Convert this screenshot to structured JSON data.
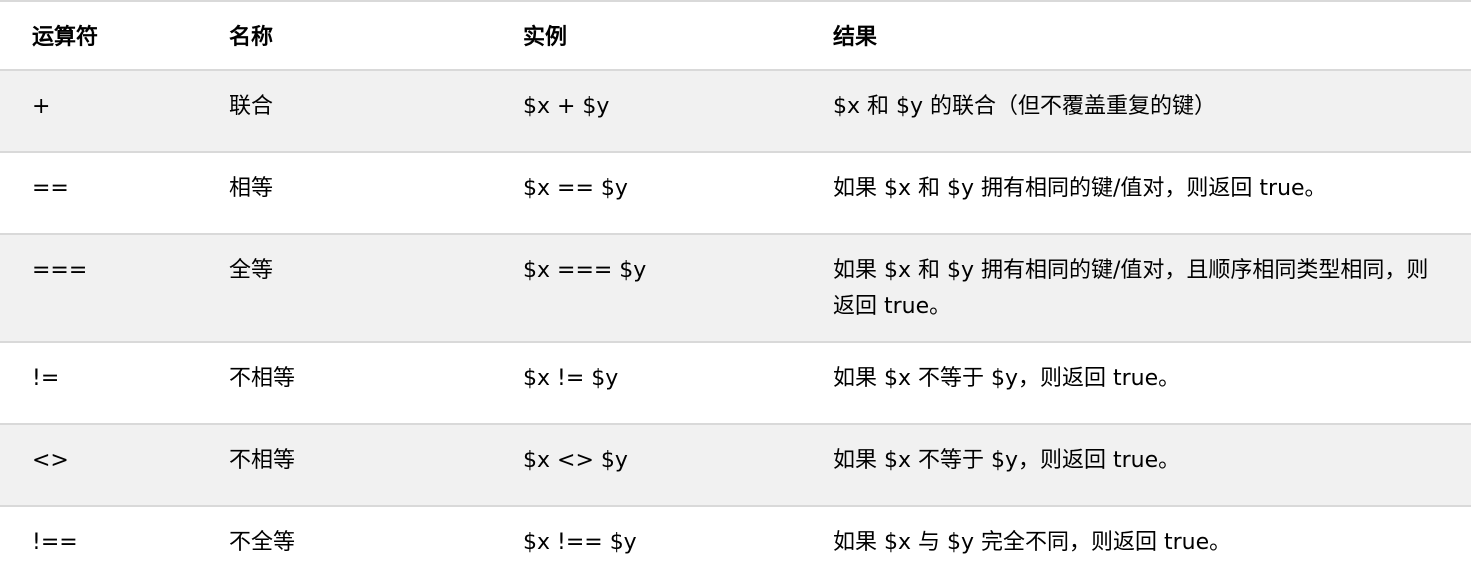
{
  "table": {
    "headers": [
      "运算符",
      "名称",
      "实例",
      "结果"
    ],
    "rows": [
      {
        "operator": "+",
        "name": "联合",
        "example": "$x + $y",
        "result": "$x 和 $y 的联合（但不覆盖重复的键）"
      },
      {
        "operator": "==",
        "name": "相等",
        "example": "$x == $y",
        "result": "如果 $x 和 $y 拥有相同的键/值对，则返回 true。"
      },
      {
        "operator": "===",
        "name": "全等",
        "example": "$x === $y",
        "result": "如果 $x 和 $y 拥有相同的键/值对，且顺序相同类型相同，则返回 true。"
      },
      {
        "operator": "!=",
        "name": "不相等",
        "example": "$x != $y",
        "result": "如果 $x 不等于 $y，则返回 true。"
      },
      {
        "operator": "<>",
        "name": "不相等",
        "example": "$x <> $y",
        "result": "如果 $x 不等于 $y，则返回 true。"
      },
      {
        "operator": "!==",
        "name": "不全等",
        "example": "$x !== $y",
        "result": "如果 $x 与 $y 完全不同，则返回 true。"
      }
    ]
  },
  "colors": {
    "row_shade": "#f1f1f1",
    "border": "#d9d9d9",
    "text": "#000000"
  }
}
